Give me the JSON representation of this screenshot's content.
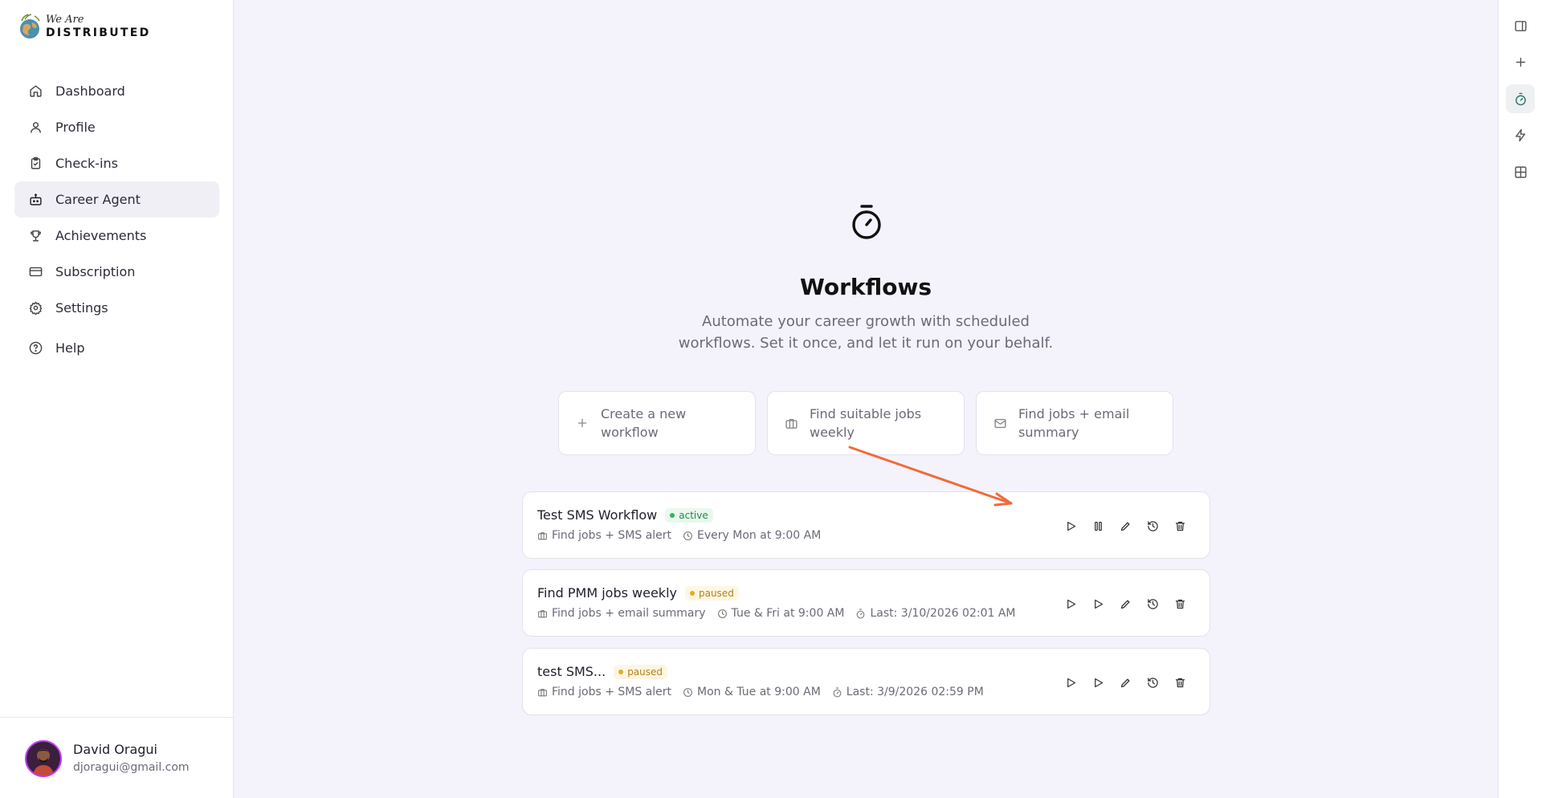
{
  "brand": {
    "line1": "We Are",
    "line2": "DISTRIBUTED"
  },
  "nav": [
    {
      "label": "Dashboard",
      "icon": "home-icon"
    },
    {
      "label": "Profile",
      "icon": "user-icon"
    },
    {
      "label": "Check-ins",
      "icon": "clipboard-check-icon"
    },
    {
      "label": "Career Agent",
      "icon": "bot-icon",
      "active": true
    },
    {
      "label": "Achievements",
      "icon": "trophy-icon"
    },
    {
      "label": "Subscription",
      "icon": "credit-card-icon"
    },
    {
      "label": "Settings",
      "icon": "gear-icon"
    },
    {
      "label": "Help",
      "icon": "help-circle-icon"
    }
  ],
  "user": {
    "name": "David Oragui",
    "email": "djoragui@gmail.com"
  },
  "main": {
    "title": "Workflows",
    "subtitle_line1": "Automate your career growth with scheduled",
    "subtitle_line2": "workflows. Set it once, and let it run on your behalf.",
    "quick_actions": [
      {
        "label": "Create a new workflow",
        "icon": "plus-icon"
      },
      {
        "label": "Find suitable jobs weekly",
        "icon": "briefcase-icon"
      },
      {
        "label": "Find jobs + email summary",
        "icon": "mail-icon"
      }
    ],
    "workflows": [
      {
        "name": "Test SMS Workflow",
        "status": "active",
        "type": "Find jobs + SMS alert",
        "schedule": "Every Mon at 9:00 AM",
        "last": ""
      },
      {
        "name": "Find PMM jobs weekly",
        "status": "paused",
        "type": "Find jobs + email summary",
        "schedule": "Tue & Fri at 9:00 AM",
        "last": "Last: 3/10/2026 02:01 AM"
      },
      {
        "name": "test SMS...",
        "status": "paused",
        "type": "Find jobs + SMS alert",
        "schedule": "Mon & Tue at 9:00 AM",
        "last": "Last: 3/9/2026 02:59 PM"
      }
    ]
  },
  "colors": {
    "accent_arrow": "#f26a3d",
    "active": "#2bb85a",
    "paused": "#e2ac26"
  }
}
